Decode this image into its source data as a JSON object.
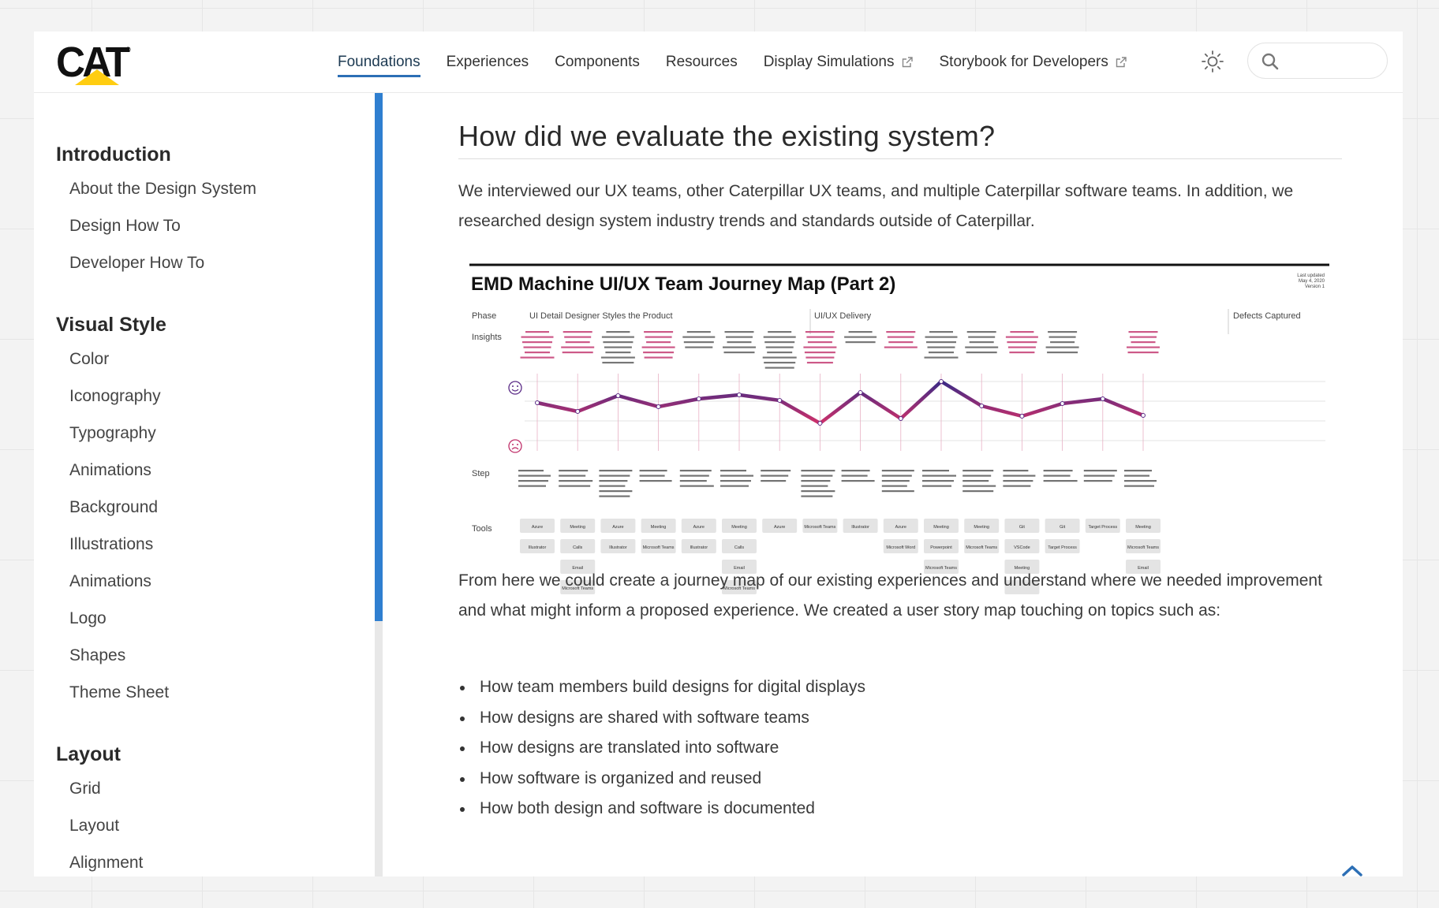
{
  "brand": {
    "logo_text": "CAT",
    "logo_mark": "®"
  },
  "nav": {
    "items": [
      {
        "label": "Foundations",
        "active": true,
        "external": false
      },
      {
        "label": "Experiences",
        "active": false,
        "external": false
      },
      {
        "label": "Components",
        "active": false,
        "external": false
      },
      {
        "label": "Resources",
        "active": false,
        "external": false
      },
      {
        "label": "Display Simulations",
        "active": false,
        "external": true
      },
      {
        "label": "Storybook for Developers",
        "active": false,
        "external": true
      }
    ],
    "theme_icon": "sun-icon",
    "search": {
      "placeholder": "",
      "value": "",
      "icon": "search-icon"
    }
  },
  "sidebar": {
    "sections": [
      {
        "title": "Introduction",
        "items": [
          "About the Design System",
          "Design How To",
          "Developer How To"
        ]
      },
      {
        "title": "Visual Style",
        "items": [
          "Color",
          "Iconography",
          "Typography",
          "Animations",
          "Background",
          "Illustrations",
          "Animations",
          "Logo",
          "Shapes",
          "Theme Sheet"
        ]
      },
      {
        "title": "Layout",
        "items": [
          "Grid",
          "Layout",
          "Alignment"
        ]
      }
    ]
  },
  "content": {
    "heading": "How did we evaluate the existing system?",
    "para1": "We interviewed our UX teams, other Caterpillar UX teams, and multiple Caterpillar software teams. In addition, we researched design system industry trends and standards outside of Caterpillar.",
    "para2": "From here we could create a journey map of our existing experiences and understand where we needed improvement and what might inform a proposed experience. We created a user story map touching on topics such as:",
    "bullets": [
      "How team members build designs for digital displays",
      "How designs are shared with software teams",
      "How designs are translated into software",
      "How software is organized and reused",
      "How both design and software is documented"
    ]
  },
  "figure": {
    "title": "EMD Machine UI/UX Team Journey Map (Part 2)",
    "updated": [
      "Last updated",
      "May 4, 2020",
      "Version 1"
    ],
    "row_labels": [
      "Phase",
      "Insights",
      "Step",
      "Tools"
    ],
    "phases": [
      "UI Detail Designer Styles the Product",
      "UI/UX Delivery",
      "Defects Captured"
    ],
    "happy_icon": "smile-face-icon",
    "sad_icon": "frown-face-icon",
    "line_color": "#5a2a86",
    "accent_color": "#c0306a",
    "tools": [
      [
        "Azure",
        "Illustrator"
      ],
      [
        "Meeting",
        "Calls",
        "Email",
        "Microsoft Teams"
      ],
      [
        "Azure",
        "Illustrator"
      ],
      [
        "Meeting",
        "Microsoft Teams"
      ],
      [
        "Azure",
        "Illustrator"
      ],
      [
        "Meeting",
        "Calls",
        "Email",
        "Microsoft Teams"
      ],
      [
        "Azure"
      ],
      [
        "Microsoft Teams"
      ],
      [
        "Illustrator"
      ],
      [
        "Azure",
        "Microsoft Word"
      ],
      [
        "Meeting",
        "Powerpoint",
        "Microsoft Teams"
      ],
      [
        "Meeting",
        "Microsoft Teams"
      ],
      [
        "Git",
        "VSCode",
        "Meeting",
        ""
      ],
      [
        "Git",
        "Target Process"
      ],
      [
        "Target Process"
      ],
      [
        "Meeting",
        "Microsoft Teams",
        "Email"
      ]
    ]
  },
  "colors": {
    "accent": "#2c6fb5",
    "brand_yellow": "#ffcd11",
    "scrollbar": "#2f7fd0"
  }
}
